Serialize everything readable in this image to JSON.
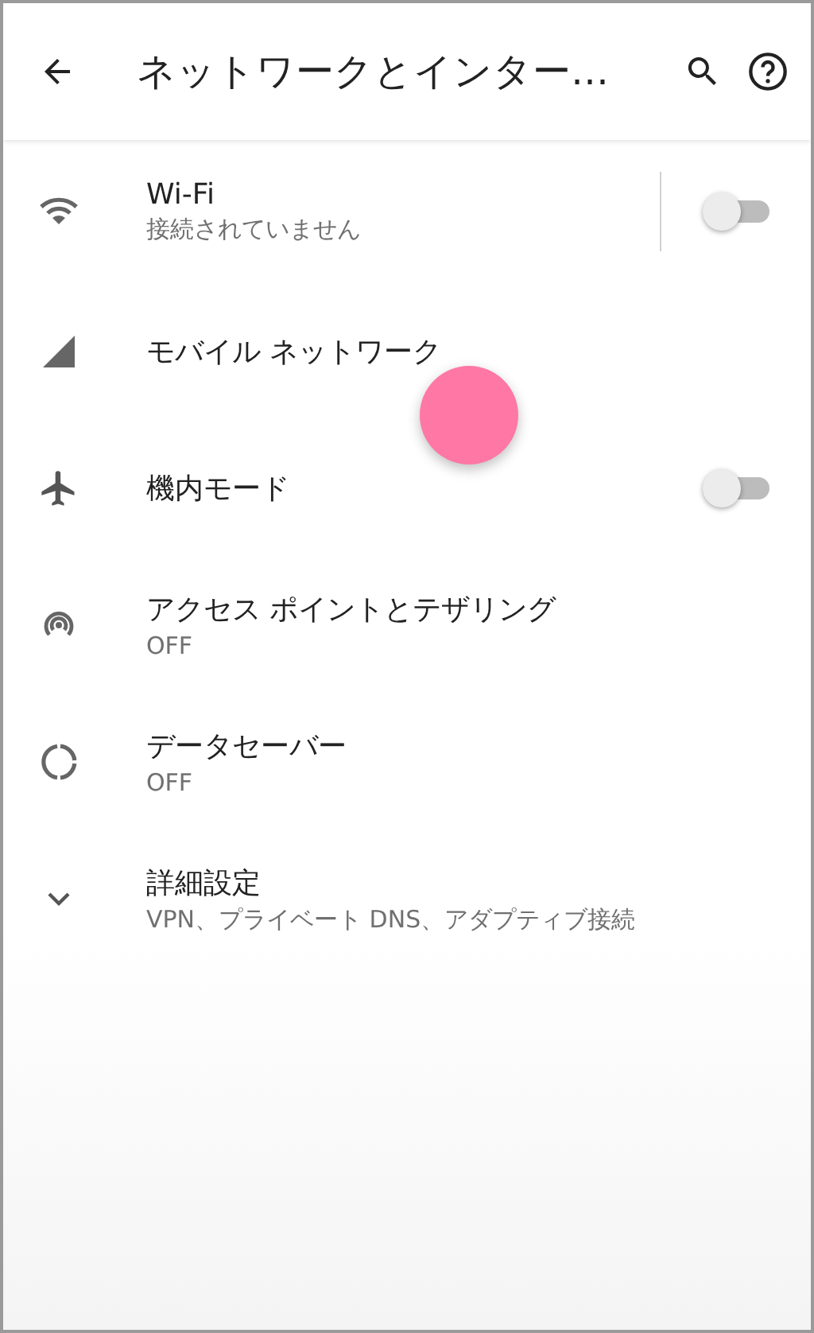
{
  "app_bar": {
    "title": "ネットワークとインター…"
  },
  "items": [
    {
      "kind": "toggle",
      "title": "Wi-Fi",
      "summary": "接続されていません",
      "on": false,
      "divider": true
    },
    {
      "kind": "plain",
      "title": "モバイル ネットワーク"
    },
    {
      "kind": "toggle",
      "title": "機内モード",
      "on": false,
      "divider": false
    },
    {
      "kind": "plain",
      "title": "アクセス ポイントとテザリング",
      "summary": "OFF"
    },
    {
      "kind": "plain",
      "title": "データセーバー",
      "summary": "OFF"
    },
    {
      "kind": "expand",
      "title": "詳細設定",
      "summary": "VPN、プライベート DNS、アダプティブ接続",
      "expanded": false
    }
  ],
  "touch_indicator": {
    "shown": true
  }
}
